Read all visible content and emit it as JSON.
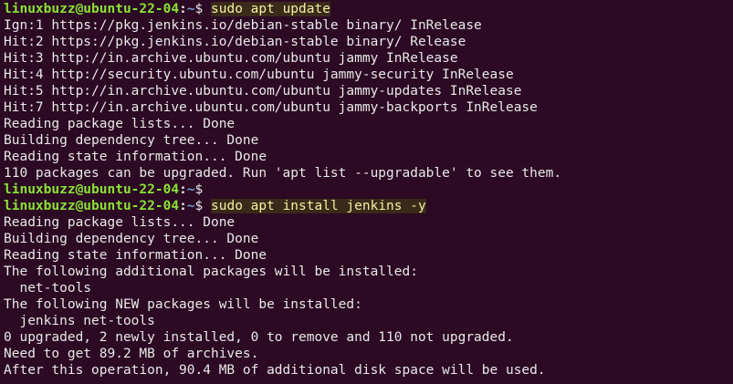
{
  "prompt": {
    "user_host": "linuxbuzz@ubuntu-22-04",
    "colon": ":",
    "path": "~",
    "symbol": "$"
  },
  "commands": {
    "update": "sudo apt update",
    "install": "sudo apt install jenkins -y"
  },
  "output_update": [
    "Ign:1 https://pkg.jenkins.io/debian-stable binary/ InRelease",
    "Hit:2 https://pkg.jenkins.io/debian-stable binary/ Release",
    "Hit:3 http://in.archive.ubuntu.com/ubuntu jammy InRelease",
    "Hit:4 http://security.ubuntu.com/ubuntu jammy-security InRelease",
    "Hit:5 http://in.archive.ubuntu.com/ubuntu jammy-updates InRelease",
    "Hit:7 http://in.archive.ubuntu.com/ubuntu jammy-backports InRelease",
    "Reading package lists... Done",
    "Building dependency tree... Done",
    "Reading state information... Done",
    "110 packages can be upgraded. Run 'apt list --upgradable' to see them."
  ],
  "output_install": [
    "Reading package lists... Done",
    "Building dependency tree... Done",
    "Reading state information... Done",
    "The following additional packages will be installed:",
    "  net-tools",
    "The following NEW packages will be installed:",
    "  jenkins net-tools",
    "0 upgraded, 2 newly installed, 0 to remove and 110 not upgraded.",
    "Need to get 89.2 MB of archives.",
    "After this operation, 90.4 MB of additional disk space will be used."
  ]
}
